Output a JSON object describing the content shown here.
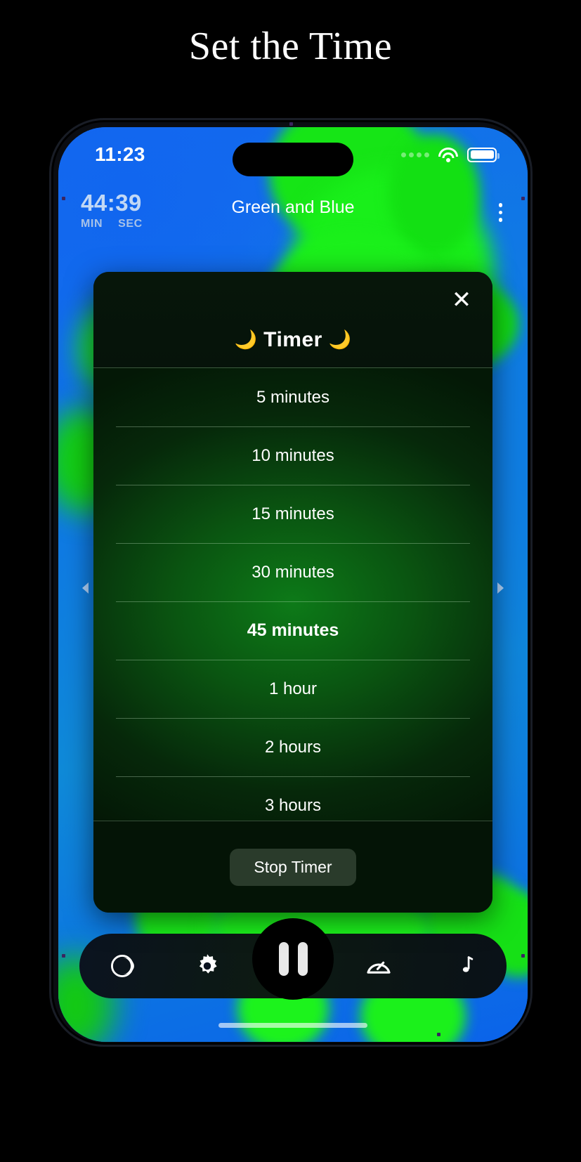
{
  "page": {
    "heading": "Set the Time",
    "background_color": "#000000"
  },
  "phone": {
    "status_bar": {
      "time": "11:23",
      "cellular_icon": "cellular-dots-icon",
      "wifi_icon": "wifi-icon",
      "battery_icon": "battery-icon"
    },
    "app_bar": {
      "elapsed_time": "44:39",
      "unit_minutes": "MIN",
      "unit_seconds": "SEC",
      "track_title": "Green and Blue",
      "overflow_icon": "kebab-menu-icon"
    },
    "side_controls": {
      "prev_icon": "chevron-left-icon",
      "next_icon": "chevron-right-icon"
    },
    "timer_modal": {
      "close_icon": "close-x-icon",
      "title": "Timer",
      "moon_left": "🌙",
      "moon_right": "🌙",
      "options": [
        {
          "label": "5 minutes",
          "selected": false
        },
        {
          "label": "10 minutes",
          "selected": false
        },
        {
          "label": "15 minutes",
          "selected": false
        },
        {
          "label": "30 minutes",
          "selected": false
        },
        {
          "label": "45 minutes",
          "selected": true
        },
        {
          "label": "1 hour",
          "selected": false
        },
        {
          "label": "2 hours",
          "selected": false
        },
        {
          "label": "3 hours",
          "selected": false
        }
      ],
      "stop_button": "Stop Timer",
      "selected_option": "45 minutes",
      "accent_color": "#0d7a18"
    },
    "bottom_nav": {
      "items": [
        {
          "icon": "sleep-timer-icon"
        },
        {
          "icon": "brightness-icon"
        },
        {
          "icon": "pause-icon"
        },
        {
          "icon": "speed-gauge-icon"
        },
        {
          "icon": "music-note-icon"
        }
      ]
    },
    "home_indicator": "home-indicator"
  }
}
